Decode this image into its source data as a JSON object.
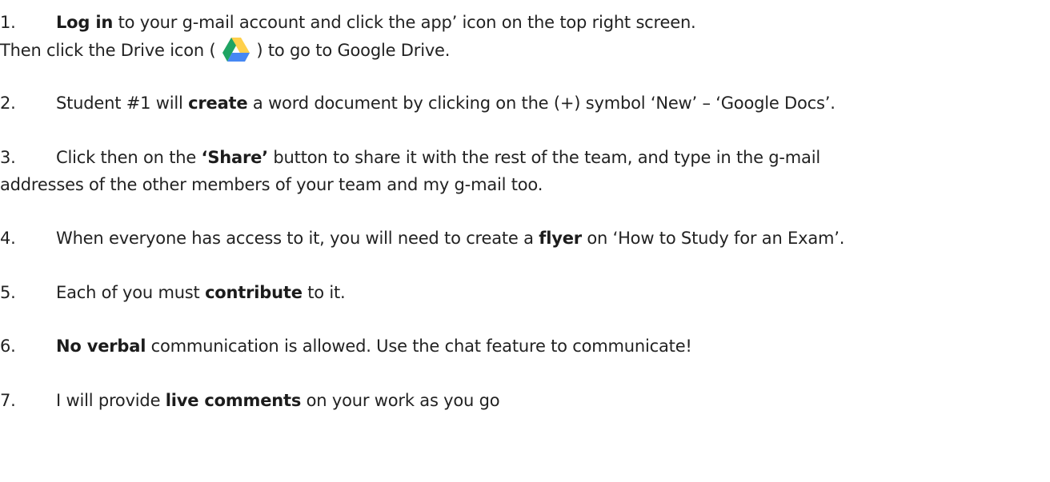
{
  "steps": [
    {
      "number": "1.",
      "bold": "Log in",
      "rest": " to your g-mail account and click the app’ icon on the top right screen.",
      "line2_before": "Then click the Drive icon (",
      "line2_icon": "google-drive-icon",
      "line2_after": ") to go to Google Drive."
    },
    {
      "number": "2.",
      "before": "Student #1 will ",
      "bold": "create",
      "after": " a word document by clicking on the (+) symbol ‘New’ – ‘Google Docs’."
    },
    {
      "number": "3.",
      "before": "Click then on the ",
      "bold": "‘Share’",
      "after": " button to share it with the rest of the team, and type in the g-mail",
      "line2": "addresses of the other members of your team and my g-mail too."
    },
    {
      "number": "4.",
      "before": "When everyone has access to it, you will need to create a ",
      "bold": "flyer",
      "after": " on ‘How to Study for an Exam’."
    },
    {
      "number": "5.",
      "before": "Each of you must ",
      "bold": "contribute",
      "after": " to it."
    },
    {
      "number": "6.",
      "bold": "No verbal",
      "after": " communication is allowed. Use the chat feature to communicate!"
    },
    {
      "number": "7.",
      "before": "I will provide ",
      "bold": "live comments",
      "after": " on your work as you go"
    }
  ],
  "colors": {
    "text": "#222222",
    "drive_green": "#1FA463",
    "drive_yellow": "#FFD04B",
    "drive_blue": "#4688F4"
  }
}
